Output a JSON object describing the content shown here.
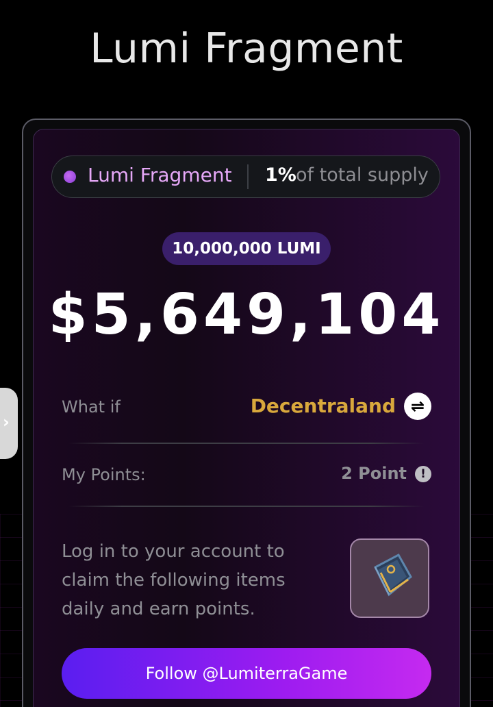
{
  "header": {
    "title": "Lumi Fragment"
  },
  "token": {
    "name": "Lumi Fragment",
    "percent": "1%",
    "supply_text": "of total supply",
    "amount_badge": "10,000,000 LUMI",
    "value": "$5,649,104"
  },
  "what_if": {
    "label": "What if",
    "project": "Decentraland",
    "swap_icon": "swap-arrows-icon"
  },
  "points": {
    "label": "My Points:",
    "value": "2 Point",
    "info_icon": "exclamation-info-icon"
  },
  "claim": {
    "text": "Log in to your account to claim the following items daily and earn points."
  },
  "cta": {
    "label": "Follow @LumiterraGame"
  },
  "side_tab": {
    "icon": "chevron-right-icon"
  },
  "colors": {
    "accent_pink": "#e6a8f8",
    "gold": "#d9a83c",
    "button_gradient_start": "#5a1ef0",
    "button_gradient_end": "#c52af0",
    "badge_bg": "#3a1f6b"
  }
}
